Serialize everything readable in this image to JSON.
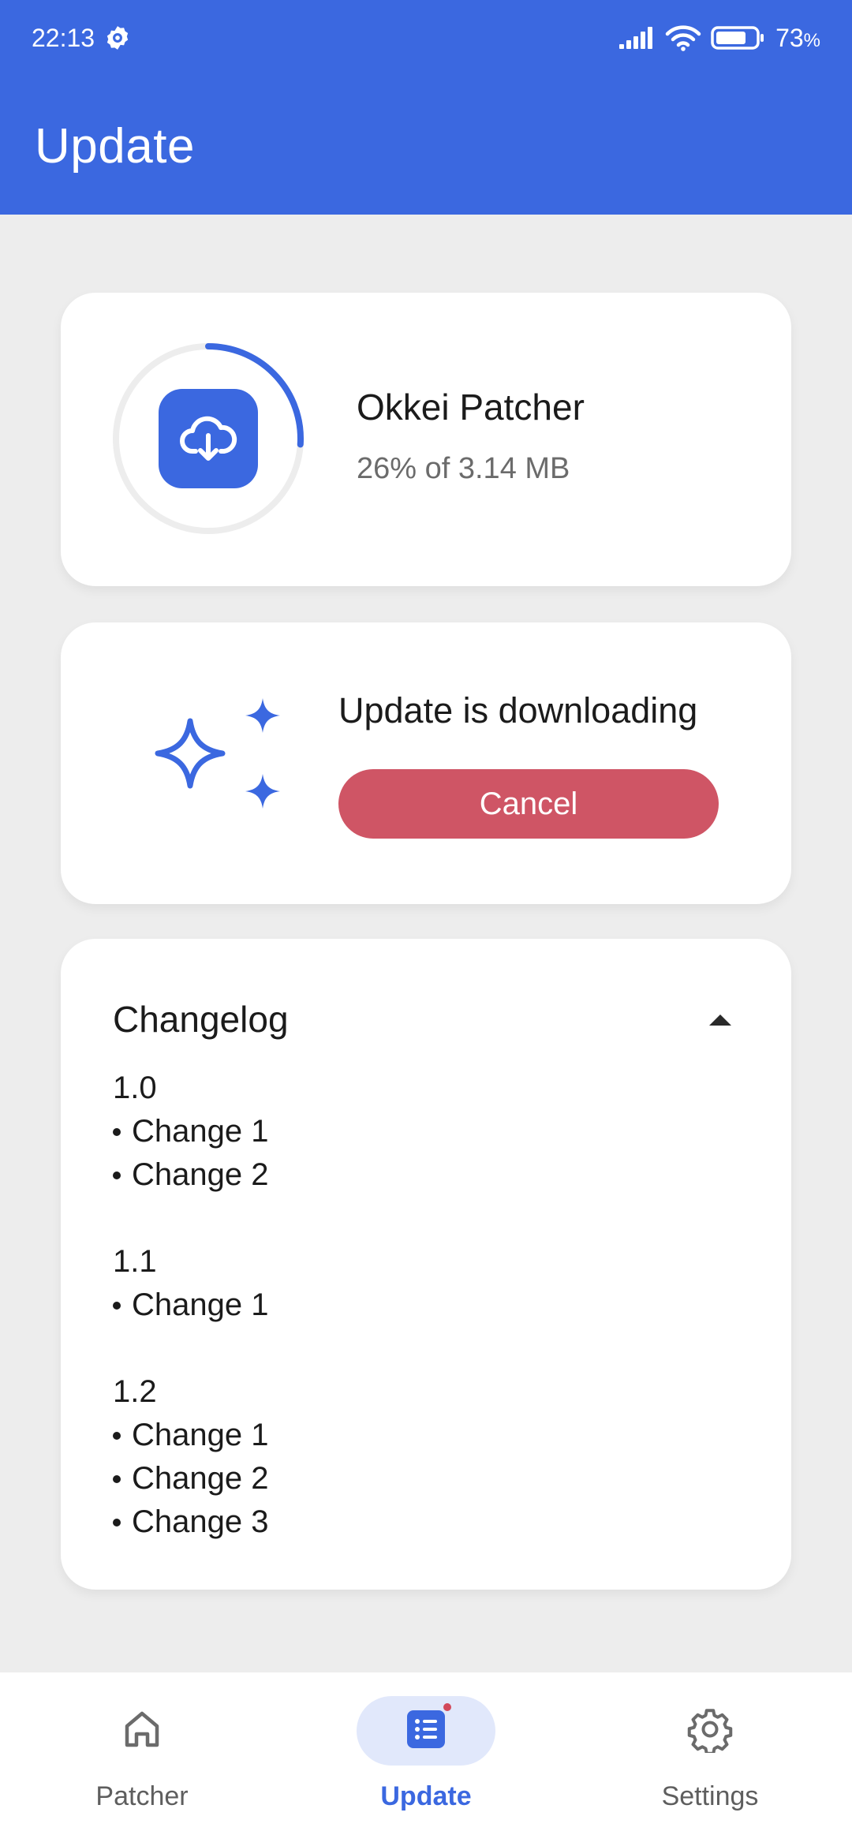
{
  "status_bar": {
    "time": "22:13",
    "battery": "73",
    "battery_unit": "%",
    "icons": [
      "settings-badge-icon",
      "signal-icon",
      "wifi-icon",
      "battery-icon"
    ]
  },
  "header": {
    "title": "Update"
  },
  "download": {
    "app_name": "Okkei Patcher",
    "progress_text": "26% of 3.14 MB",
    "progress_fraction": 0.26,
    "icon": "cloud-download-icon"
  },
  "update_status": {
    "message": "Update is downloading",
    "cancel_label": "Cancel",
    "icon": "sparkles-icon"
  },
  "changelog": {
    "title": "Changelog",
    "versions": [
      {
        "version": "1.0",
        "changes": [
          "Change 1",
          "Change 2"
        ]
      },
      {
        "version": "1.1",
        "changes": [
          "Change 1"
        ]
      },
      {
        "version": "1.2",
        "changes": [
          "Change 1",
          "Change 2",
          "Change 3"
        ]
      }
    ]
  },
  "nav": {
    "items": [
      {
        "label": "Patcher",
        "icon": "home-icon"
      },
      {
        "label": "Update",
        "icon": "list-icon"
      },
      {
        "label": "Settings",
        "icon": "gear-icon"
      }
    ],
    "active_index": 1
  },
  "colors": {
    "primary": "#3b68e0",
    "cancel": "#cf5565",
    "background": "#ededed",
    "badge": "#d2495a"
  }
}
